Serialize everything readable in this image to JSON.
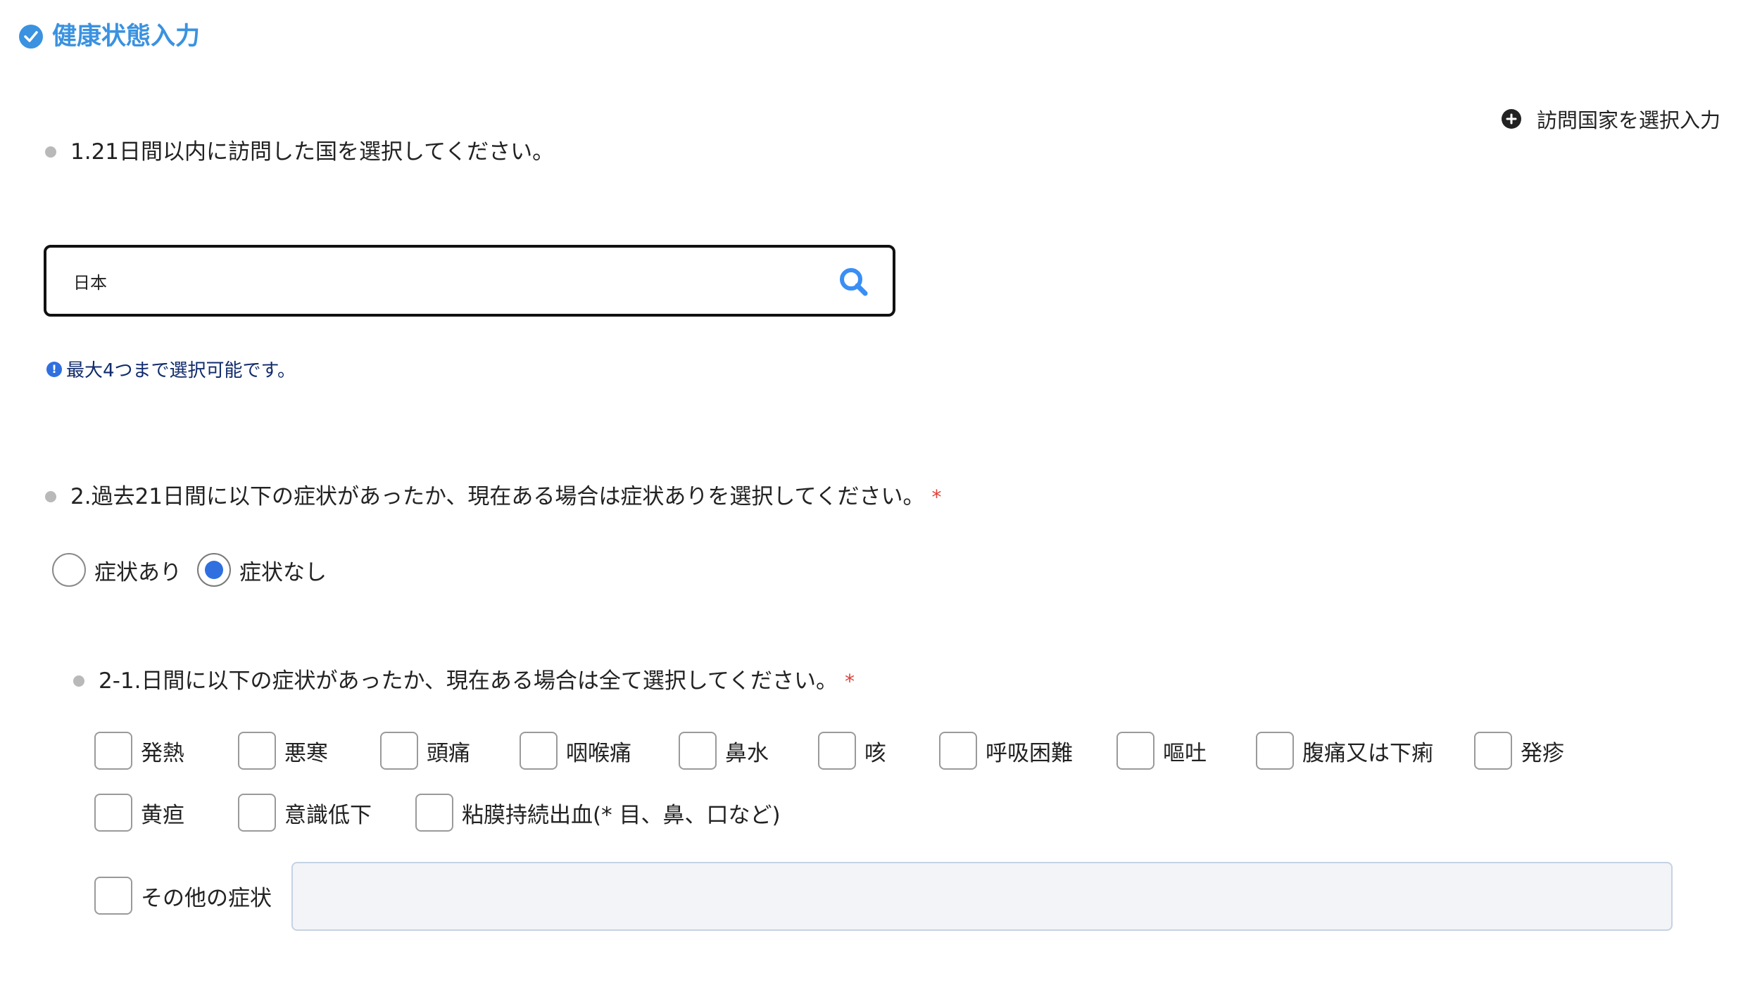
{
  "section": {
    "title": "健康状態入力",
    "icon": "check-circle-icon",
    "accent_color": "#3a92e0"
  },
  "add_country": {
    "label": "訪問国家を選択入力",
    "icon": "plus-circle-icon"
  },
  "question1": {
    "text": "1.21日間以内に訪問した国を選択してください。"
  },
  "search": {
    "value": "日本",
    "icon": "search-icon"
  },
  "hint": {
    "icon_glyph": "!",
    "text": "最大4つまで選択可能です。",
    "color": "#102a6b"
  },
  "question2": {
    "text": "2.過去21日間に以下の症状があったか、現在ある場合は症状ありを選択してください。",
    "required_mark": "*",
    "options": [
      {
        "label": "症状あり",
        "selected": false
      },
      {
        "label": "症状なし",
        "selected": true
      }
    ]
  },
  "question2_1": {
    "text": "2-1.日間に以下の症状があったか、現在ある場合は全て選択してください。",
    "required_mark": "*",
    "symptoms": [
      "発熱",
      "悪寒",
      "頭痛",
      "咽喉痛",
      "鼻水",
      "咳",
      "呼吸困難",
      "嘔吐",
      "腹痛又は下痢",
      "発疹",
      "黄疸",
      "意識低下",
      "粘膜持続出血(* 目、鼻、口など)"
    ],
    "other_label": "その他の症状",
    "other_value": ""
  }
}
